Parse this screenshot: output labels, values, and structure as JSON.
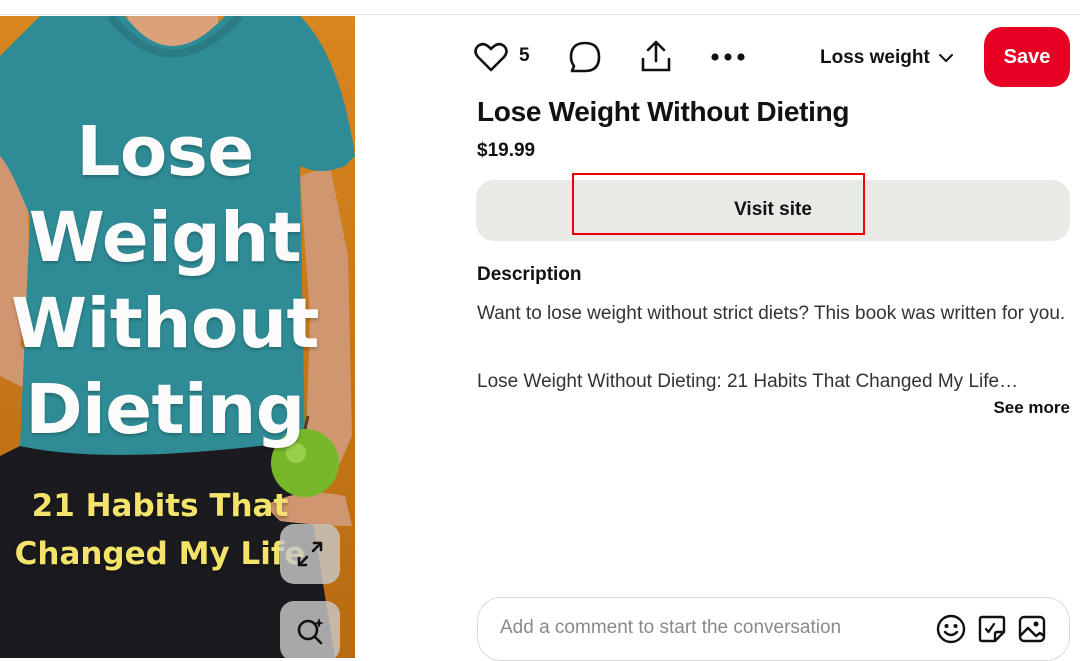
{
  "cover": {
    "title_lines": [
      "Lose",
      "Weight",
      "Without",
      "Dieting"
    ],
    "subtitle_lines": [
      "21 Habits That",
      "Changed My Life"
    ]
  },
  "actions": {
    "like_count": "5",
    "board_name": "Loss weight",
    "save_label": "Save"
  },
  "pin": {
    "title": "Lose Weight Without Dieting",
    "price": "$19.99",
    "visit_label": "Visit site",
    "description_heading": "Description",
    "description_p1": "Want to lose weight without strict diets? This book was written for you.",
    "description_p2": "Lose Weight Without Dieting: 21 Habits That Changed My Life…",
    "see_more": "See more"
  },
  "comment": {
    "placeholder": "Add a comment to start the conversation"
  },
  "colors": {
    "save": "#e60023",
    "visit_bg": "#e9e9e5",
    "highlight": "#e00000"
  },
  "icons": [
    "heart-icon",
    "comment-icon",
    "share-icon",
    "more-icon",
    "chevron-down-icon",
    "expand-icon",
    "visual-search-icon",
    "emoji-icon",
    "sticker-icon",
    "image-icon"
  ]
}
